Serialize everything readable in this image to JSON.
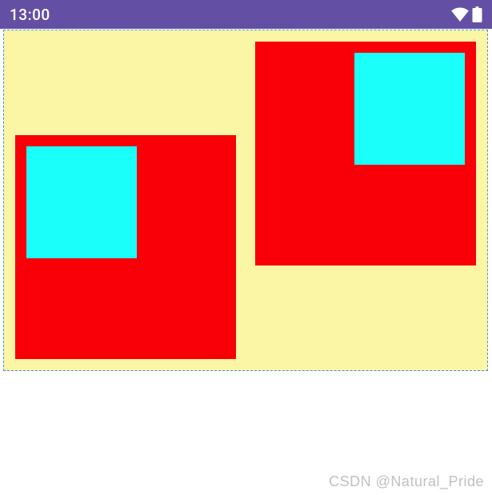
{
  "status": {
    "time": "13:00"
  },
  "watermark": "CSDN @Natural_Pride",
  "layout": {
    "container": {
      "bg": "#fbf6a6",
      "border": "dashed 1px #4091e4"
    },
    "red_boxes": [
      {
        "id": "a",
        "align": "bottom-left",
        "inner_cyan_align": "top-left"
      },
      {
        "id": "b",
        "align": "top-right",
        "inner_cyan_align": "top-right"
      }
    ],
    "colors": {
      "red": "#f90009",
      "cyan": "#1bfffa",
      "status_bg": "#6350a4"
    }
  }
}
